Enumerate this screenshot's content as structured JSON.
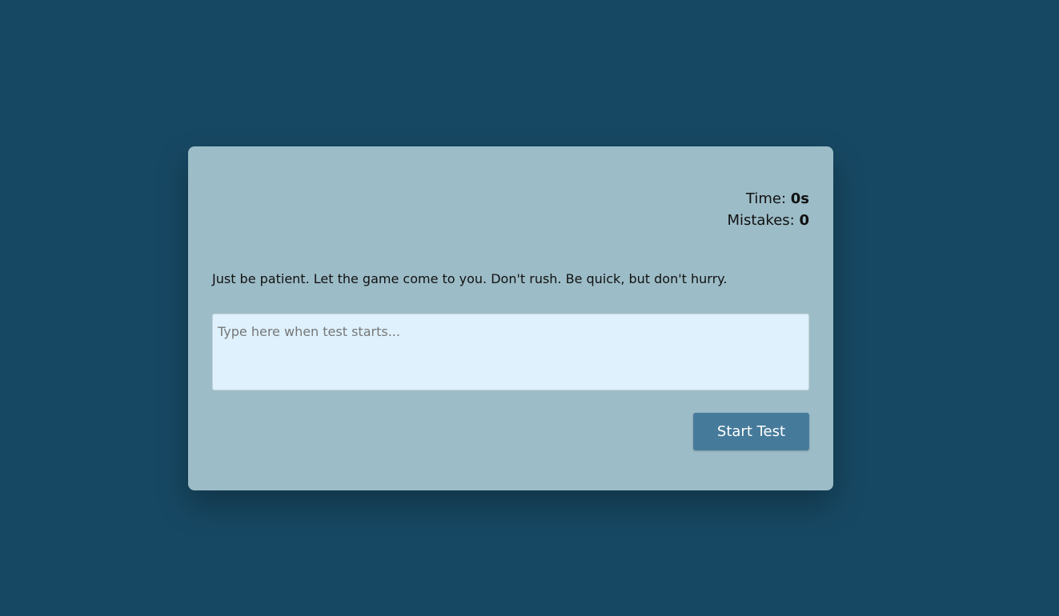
{
  "stats": {
    "time_label": "Time: ",
    "time_value": "0s",
    "mistakes_label": "Mistakes: ",
    "mistakes_value": "0"
  },
  "quote": {
    "text": "Just be patient. Let the game come to you. Don't rush. Be quick, but don't hurry."
  },
  "input": {
    "placeholder": "Type here when test starts...",
    "value": ""
  },
  "actions": {
    "start_label": "Start Test"
  },
  "colors": {
    "background": "#174863",
    "card": "#9cbcc7",
    "input_background": "#def1fd",
    "button": "#467a9b",
    "button_text": "#ffffff"
  }
}
